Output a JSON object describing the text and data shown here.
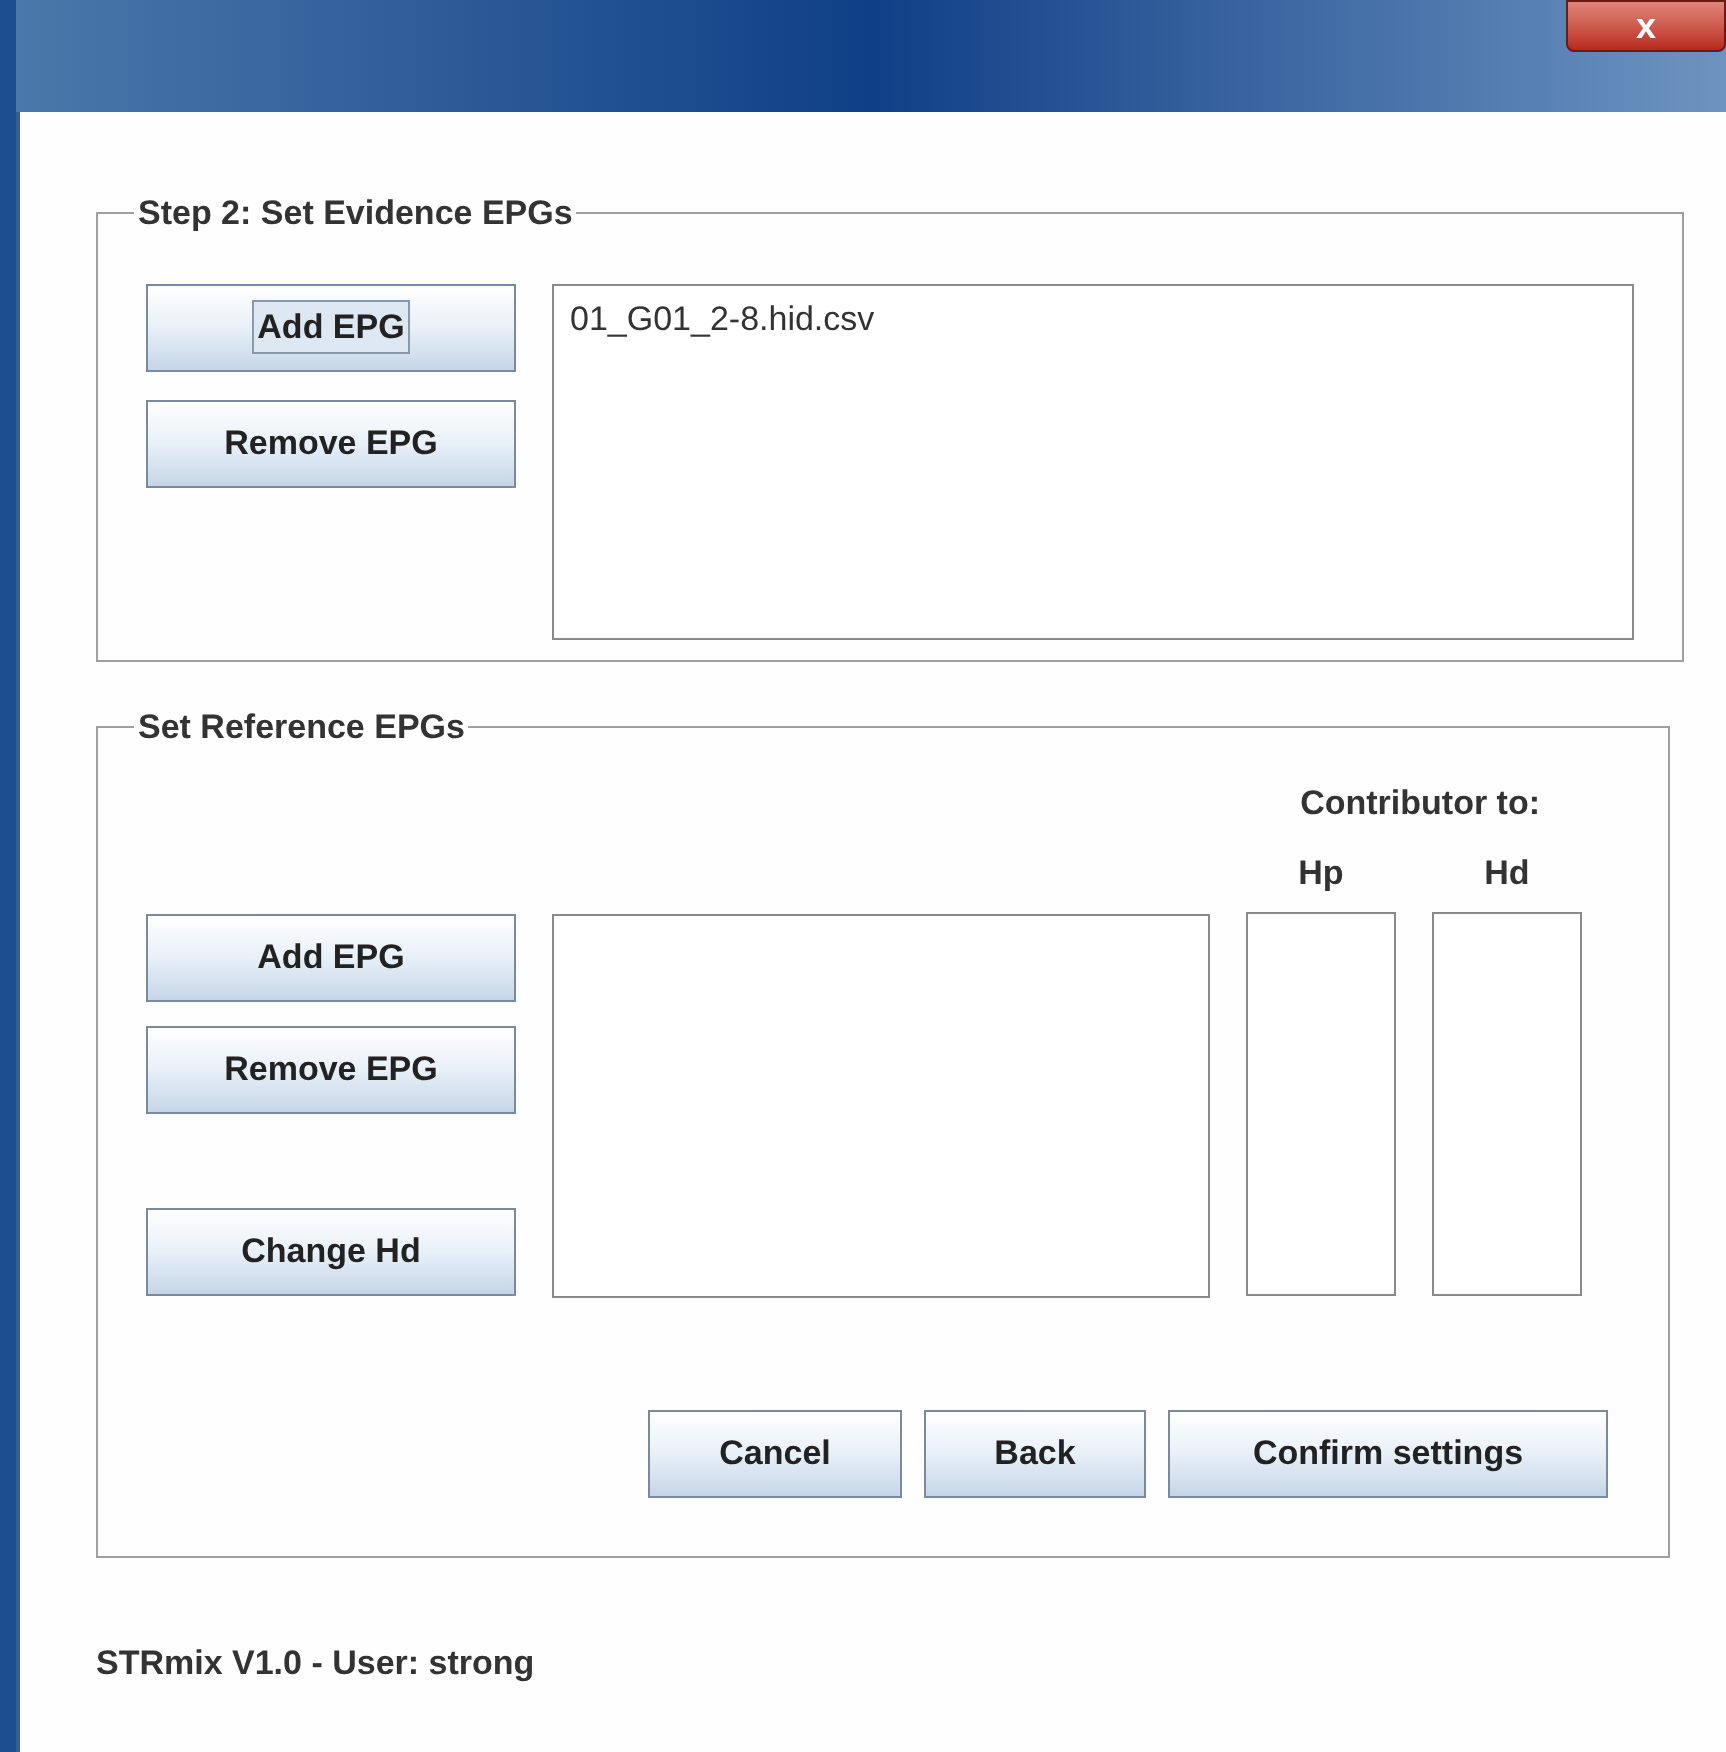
{
  "window": {
    "close_label": "x"
  },
  "evidence": {
    "title": "Step 2: Set Evidence EPGs",
    "buttons": [
      {
        "label": "Add EPG",
        "focused": true
      },
      {
        "label": "Remove EPG",
        "focused": false
      }
    ],
    "files": [
      "01_G01_2-8.hid.csv"
    ]
  },
  "reference": {
    "title": "Set Reference EPGs",
    "contributor_label": "Contributor to:",
    "hp_label": "Hp",
    "hd_label": "Hd",
    "buttons": [
      {
        "label": "Add EPG",
        "focused": false
      },
      {
        "label": "Remove EPG",
        "focused": false
      },
      {
        "label": "Change Hd",
        "focused": false
      }
    ]
  },
  "actions": [
    {
      "label": "Cancel"
    },
    {
      "label": "Back"
    },
    {
      "label": "Confirm settings"
    }
  ],
  "status_bar": "STRmix V1.0 - User: strong"
}
